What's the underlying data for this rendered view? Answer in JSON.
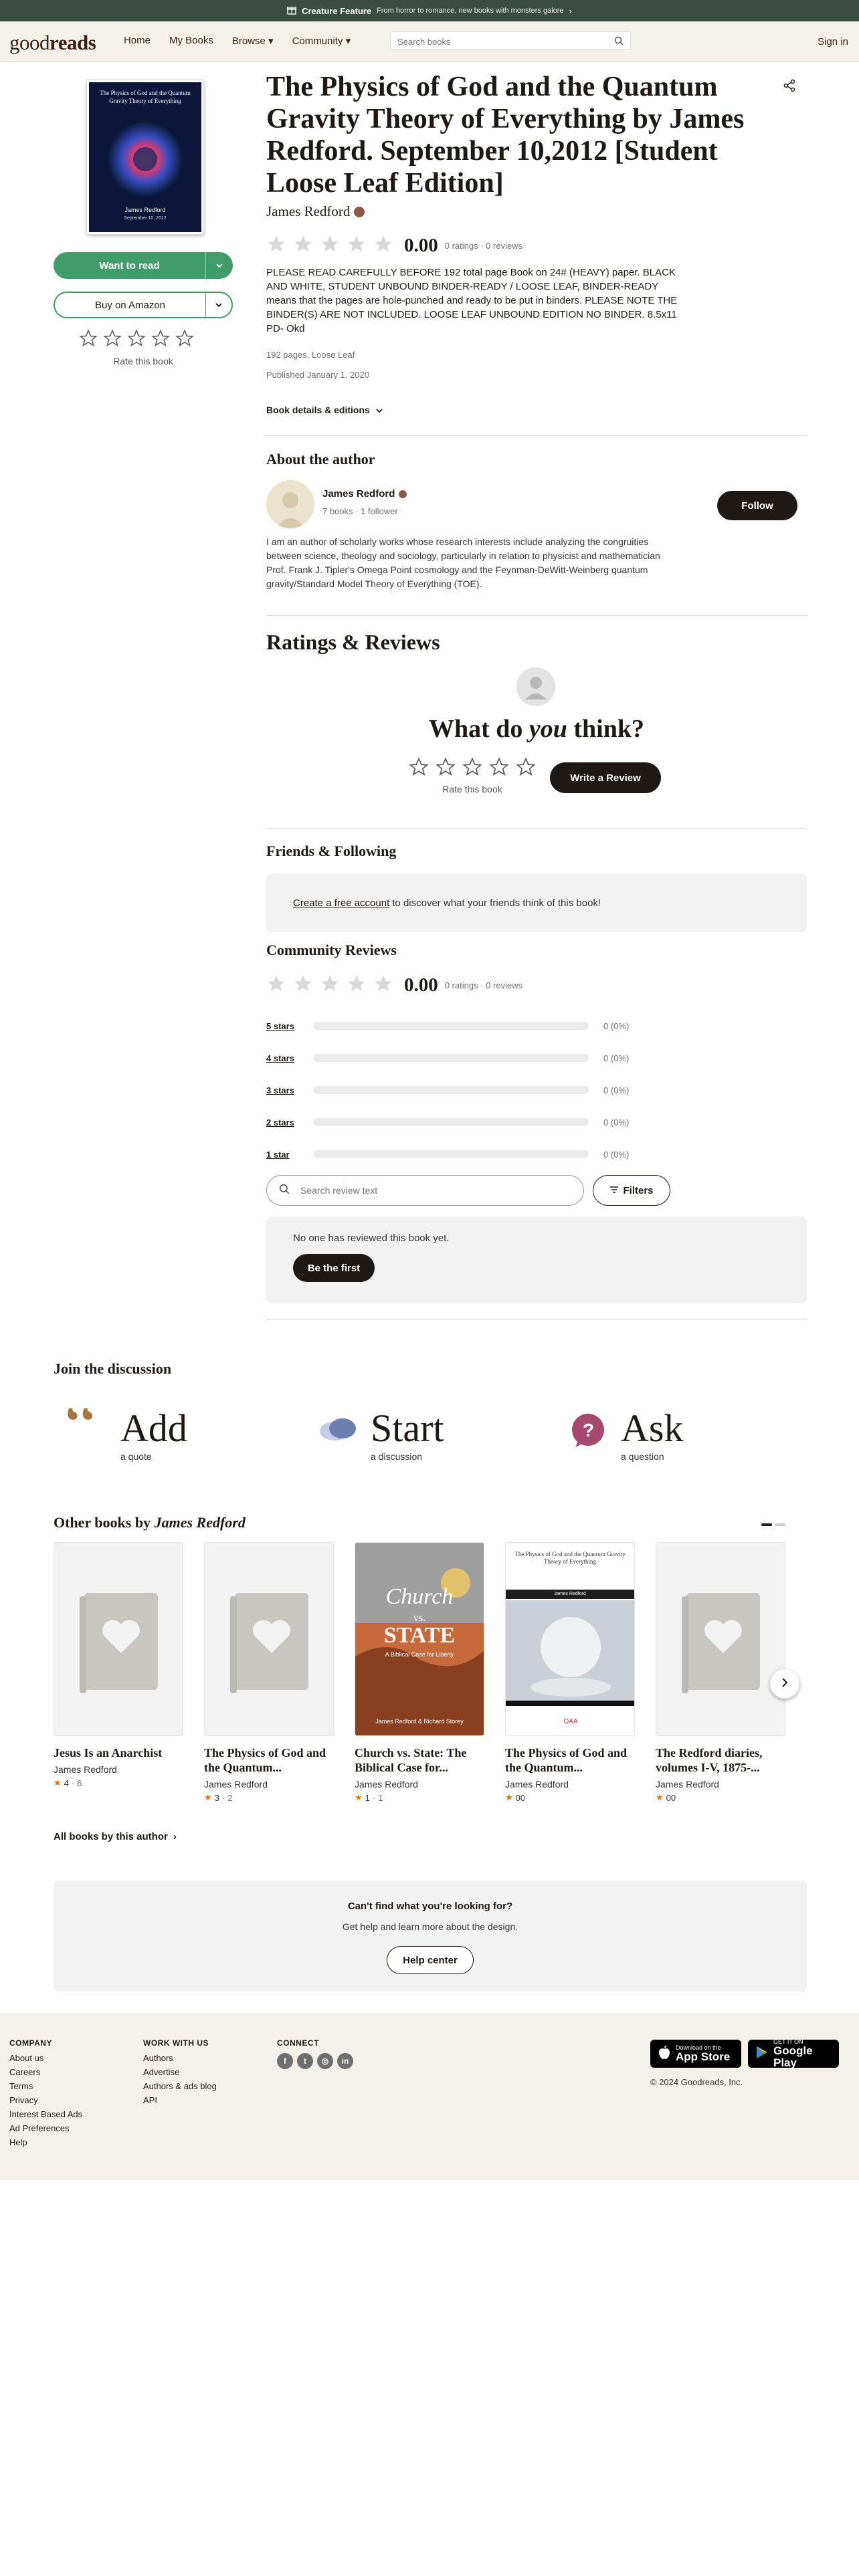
{
  "banner": {
    "title": "Creature Feature",
    "subtitle": "From horror to romance, new books with monsters galore"
  },
  "nav": {
    "logo_a": "good",
    "logo_b": "reads",
    "home": "Home",
    "mybooks": "My Books",
    "browse": "Browse ▾",
    "community": "Community ▾",
    "search_placeholder": "Search books",
    "signin": "Sign in"
  },
  "book": {
    "cover_title": "The Physics of God and the Quantum Gravity Theory of Everything",
    "cover_author": "James Redford",
    "cover_date": "September 10, 2012",
    "title": "The Physics of God and the Quantum Gravity Theory of Everything by James Redford. September 10,2012 [Student Loose Leaf Edition]",
    "author": "James Redford",
    "rating": "0.00",
    "rating_meta": "0 ratings · 0 reviews",
    "description": "PLEASE READ CAREFULLY BEFORE 192 total page Book on 24# (HEAVY) paper. BLACK AND WHITE, STUDENT UNBOUND BINDER-READY / LOOSE LEAF, BINDER-READY means that the pages are hole-punched and ready to be put in binders. PLEASE NOTE THE BINDER(S) ARE NOT INCLUDED. LOOSE LEAF UNBOUND EDITION NO BINDER. 8.5x11 PD- Okd",
    "pages": "192 pages, Loose Leaf",
    "published": "Published January 1, 2020",
    "details_label": "Book details & editions"
  },
  "left": {
    "want_to_read": "Want to read",
    "buy": "Buy on Amazon",
    "rate": "Rate this book"
  },
  "about": {
    "heading": "About the author",
    "name": "James Redford",
    "meta": "7 books · 1 follower",
    "follow": "Follow",
    "bio": "I am an author of scholarly works whose research interests include analyzing the congruities between science, theology and sociology, particularly in relation to physicist and mathematician Prof. Frank J. Tipler's Omega Point cosmology and the Feynman-DeWitt-Weinberg quantum gravity/Standard Model Theory of Everything (TOE)."
  },
  "reviews": {
    "heading": "Ratings & Reviews",
    "think_a": "What do ",
    "think_b": "you",
    "think_c": " think?",
    "rate": "Rate this book",
    "write": "Write a Review",
    "friends_heading": "Friends & Following",
    "friends_link": "Create a free account",
    "friends_text": "to discover what your friends think of this book!",
    "community_heading": "Community Reviews",
    "rating": "0.00",
    "rating_meta": "0 ratings · 0 reviews",
    "bars": [
      {
        "label": "5 stars",
        "pct": "0 (0%)"
      },
      {
        "label": "4 stars",
        "pct": "0 (0%)"
      },
      {
        "label": "3 stars",
        "pct": "0 (0%)"
      },
      {
        "label": "2 stars",
        "pct": "0 (0%)"
      },
      {
        "label": "1 star",
        "pct": "0 (0%)"
      }
    ],
    "search_placeholder": "Search review text",
    "filters": "Filters",
    "none": "No one has reviewed this book yet.",
    "be_first": "Be the first"
  },
  "discussion": {
    "heading": "Join the discussion",
    "items": [
      {
        "big": "Add",
        "sub": "a quote"
      },
      {
        "big": "Start",
        "sub": "a discussion"
      },
      {
        "big": "Ask",
        "sub": "a question"
      }
    ]
  },
  "other": {
    "heading_a": "Other books by ",
    "heading_b": "James Redford",
    "all": "All books by this author",
    "books": [
      {
        "title": "Jesus Is an Anarchist",
        "author": "James Redford",
        "rating": "4",
        "count": "6"
      },
      {
        "title": "The Physics of God and the Quantum...",
        "author": "James Redford",
        "rating": "3",
        "count": "2"
      },
      {
        "title": "Church vs. State: The Biblical Case for...",
        "author": "James Redford",
        "rating": "1",
        "count": "1",
        "cover_a": "Church",
        "cover_b": "vs.",
        "cover_c": "STATE",
        "cover_d": "A Biblical Case for Liberty",
        "cover_e": "James Redford & Richard Storey"
      },
      {
        "title": "The Physics of God and the Quantum...",
        "author": "James Redford",
        "rating": "00",
        "count": "",
        "cover_a": "The Physics of God and the Quantum Gravity Theory of Everything",
        "cover_b": "James Redford"
      },
      {
        "title": "The Redford diaries, volumes I-V, 1875-...",
        "author": "James Redford",
        "rating": "00",
        "count": ""
      }
    ]
  },
  "help": {
    "heading": "Can't find what you're looking for?",
    "text": "Get help and learn more about the design.",
    "button": "Help center"
  },
  "footer": {
    "company": "COMPANY",
    "company_items": [
      "About us",
      "Careers",
      "Terms",
      "Privacy",
      "Interest Based Ads",
      "Ad Preferences",
      "Help"
    ],
    "work": "WORK WITH US",
    "work_items": [
      "Authors",
      "Advertise",
      "Authors & ads blog",
      "API"
    ],
    "connect": "CONNECT",
    "appstore_a": "Download on the",
    "appstore_b": "App Store",
    "google_a": "GET IT ON",
    "google_b": "Google Play",
    "copyright": "© 2024 Goodreads, Inc."
  },
  "colors": {
    "green": "#409d69",
    "dark": "#1e1915",
    "nav_bg": "#f4f1ea",
    "banner_bg": "#3b4d42",
    "star": "#e87400"
  }
}
